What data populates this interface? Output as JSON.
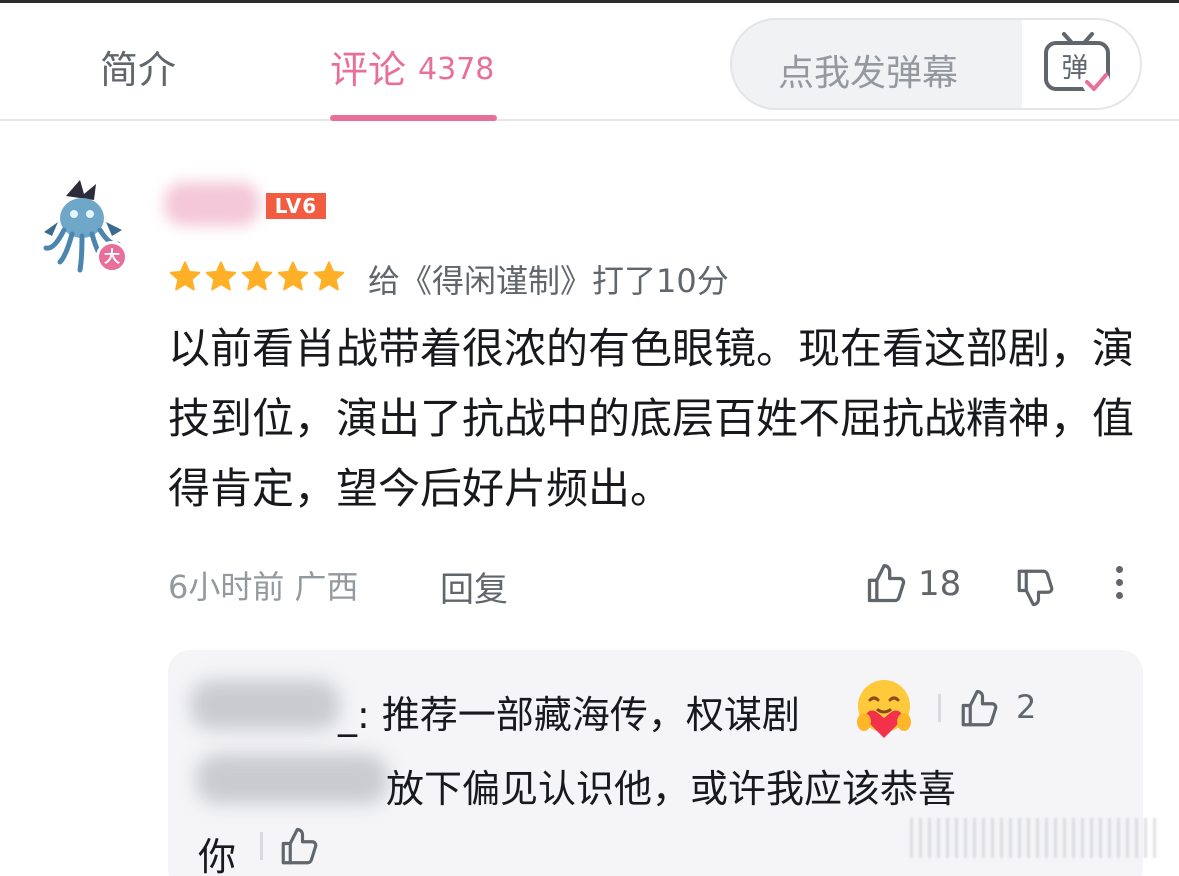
{
  "tabs": {
    "intro_label": "简介",
    "comments_label": "评论",
    "comments_count": "4378"
  },
  "danmaku": {
    "placeholder": "点我发弹幕",
    "icon_char": "弹",
    "icon": "danmaku-send-icon"
  },
  "comment": {
    "level_badge": "LV6",
    "avatar_badge": "大",
    "stars": 5,
    "rating_text": "给《得闲谨制》打了10分",
    "text": "以前看肖战带着很浓的有色眼镜。现在看这部剧，演技到位，演出了抗战中的底层百姓不屈抗战精神，值得肯定，望今后好片频出。",
    "time_location": "6小时前 广西",
    "reply_label": "回复",
    "like_count": "18"
  },
  "replies": [
    {
      "text": "_: 推荐一部藏海传，权谋剧",
      "emoji": "hug-heart-emoji",
      "like_count": "2"
    },
    {
      "text_line1": "放下偏见认识他，或许我应该恭喜",
      "text_line2": "你"
    }
  ],
  "colors": {
    "accent": "#e86f9a",
    "star": "#ffb027",
    "level_badge": "#f25d42",
    "text_primary": "#18191c",
    "text_secondary": "#61666d",
    "text_muted": "#9499a0"
  }
}
